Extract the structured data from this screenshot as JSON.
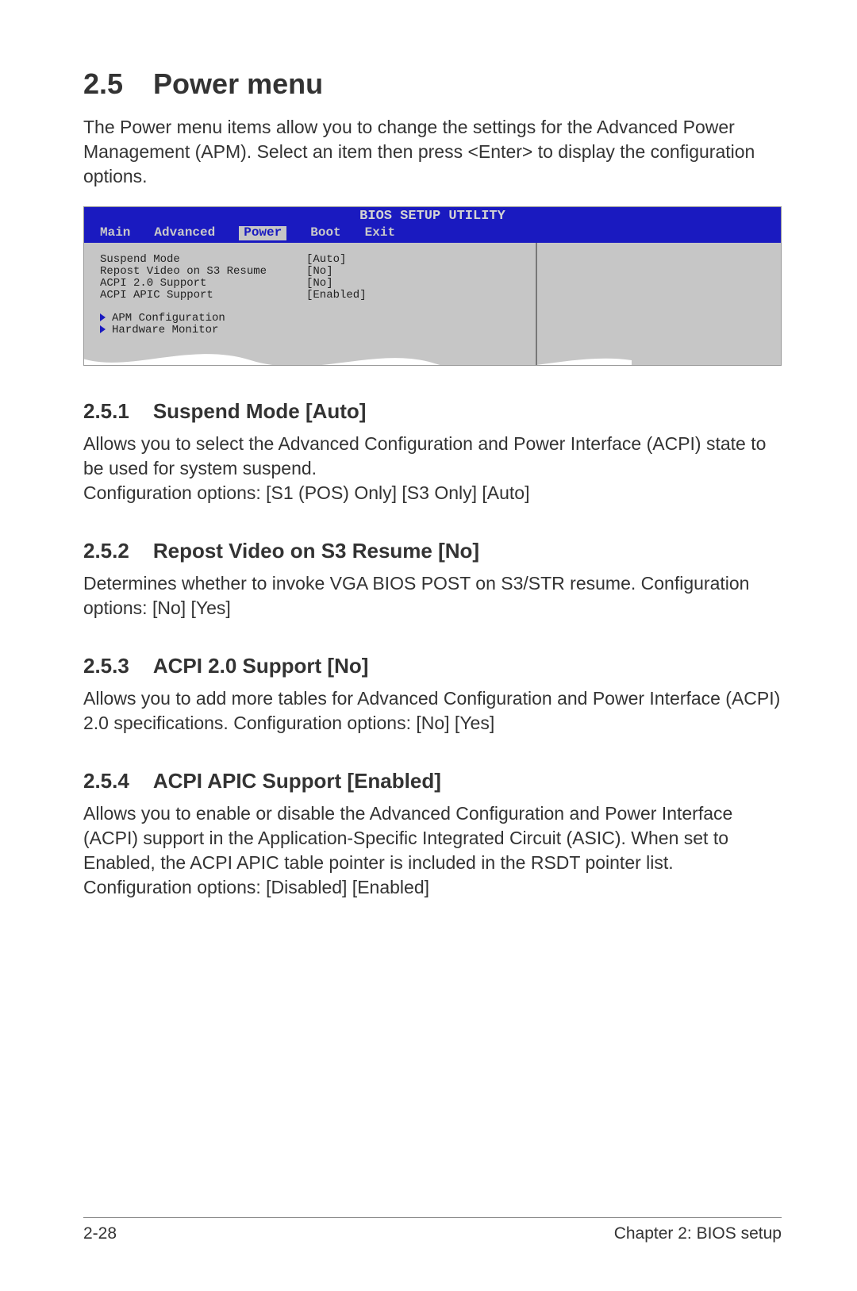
{
  "heading": {
    "num": "2.5",
    "title": "Power menu"
  },
  "intro": "The Power menu items allow you to change the settings for the Advanced Power Management (APM). Select an item then press <Enter> to display the configuration options.",
  "bios": {
    "title": "BIOS SETUP UTILITY",
    "tabs": [
      "Main",
      "Advanced",
      "Power",
      "Boot",
      "Exit"
    ],
    "active_tab_index": 2,
    "rows": [
      {
        "label": "Suspend Mode",
        "value": "[Auto]"
      },
      {
        "label": "Repost Video on S3 Resume",
        "value": "[No]"
      },
      {
        "label": "ACPI 2.0 Support",
        "value": "[No]"
      },
      {
        "label": "ACPI APIC Support",
        "value": "[Enabled]"
      }
    ],
    "submenus": [
      "APM Configuration",
      "Hardware Monitor"
    ]
  },
  "sections": [
    {
      "num": "2.5.1",
      "title": "Suspend Mode [Auto]",
      "body": "Allows you to select the Advanced Configuration and Power Interface (ACPI) state to be used for system suspend.\nConfiguration options: [S1 (POS) Only] [S3 Only] [Auto]"
    },
    {
      "num": "2.5.2",
      "title": "Repost Video on S3 Resume [No]",
      "body": "Determines whether to invoke VGA BIOS POST on S3/STR resume. Configuration options: [No] [Yes]"
    },
    {
      "num": "2.5.3",
      "title": "ACPI 2.0 Support [No]",
      "body": "Allows you to add more tables for Advanced Configuration and Power Interface (ACPI) 2.0 specifications. Configuration options: [No] [Yes]"
    },
    {
      "num": "2.5.4",
      "title": "ACPI APIC Support [Enabled]",
      "body": "Allows you to enable or disable the Advanced Configuration and Power Interface (ACPI) support in the Application-Specific Integrated Circuit (ASIC). When set to Enabled, the ACPI APIC table pointer is included in the RSDT pointer list. Configuration options: [Disabled] [Enabled]"
    }
  ],
  "footer": {
    "left": "2-28",
    "right": "Chapter 2: BIOS setup"
  }
}
